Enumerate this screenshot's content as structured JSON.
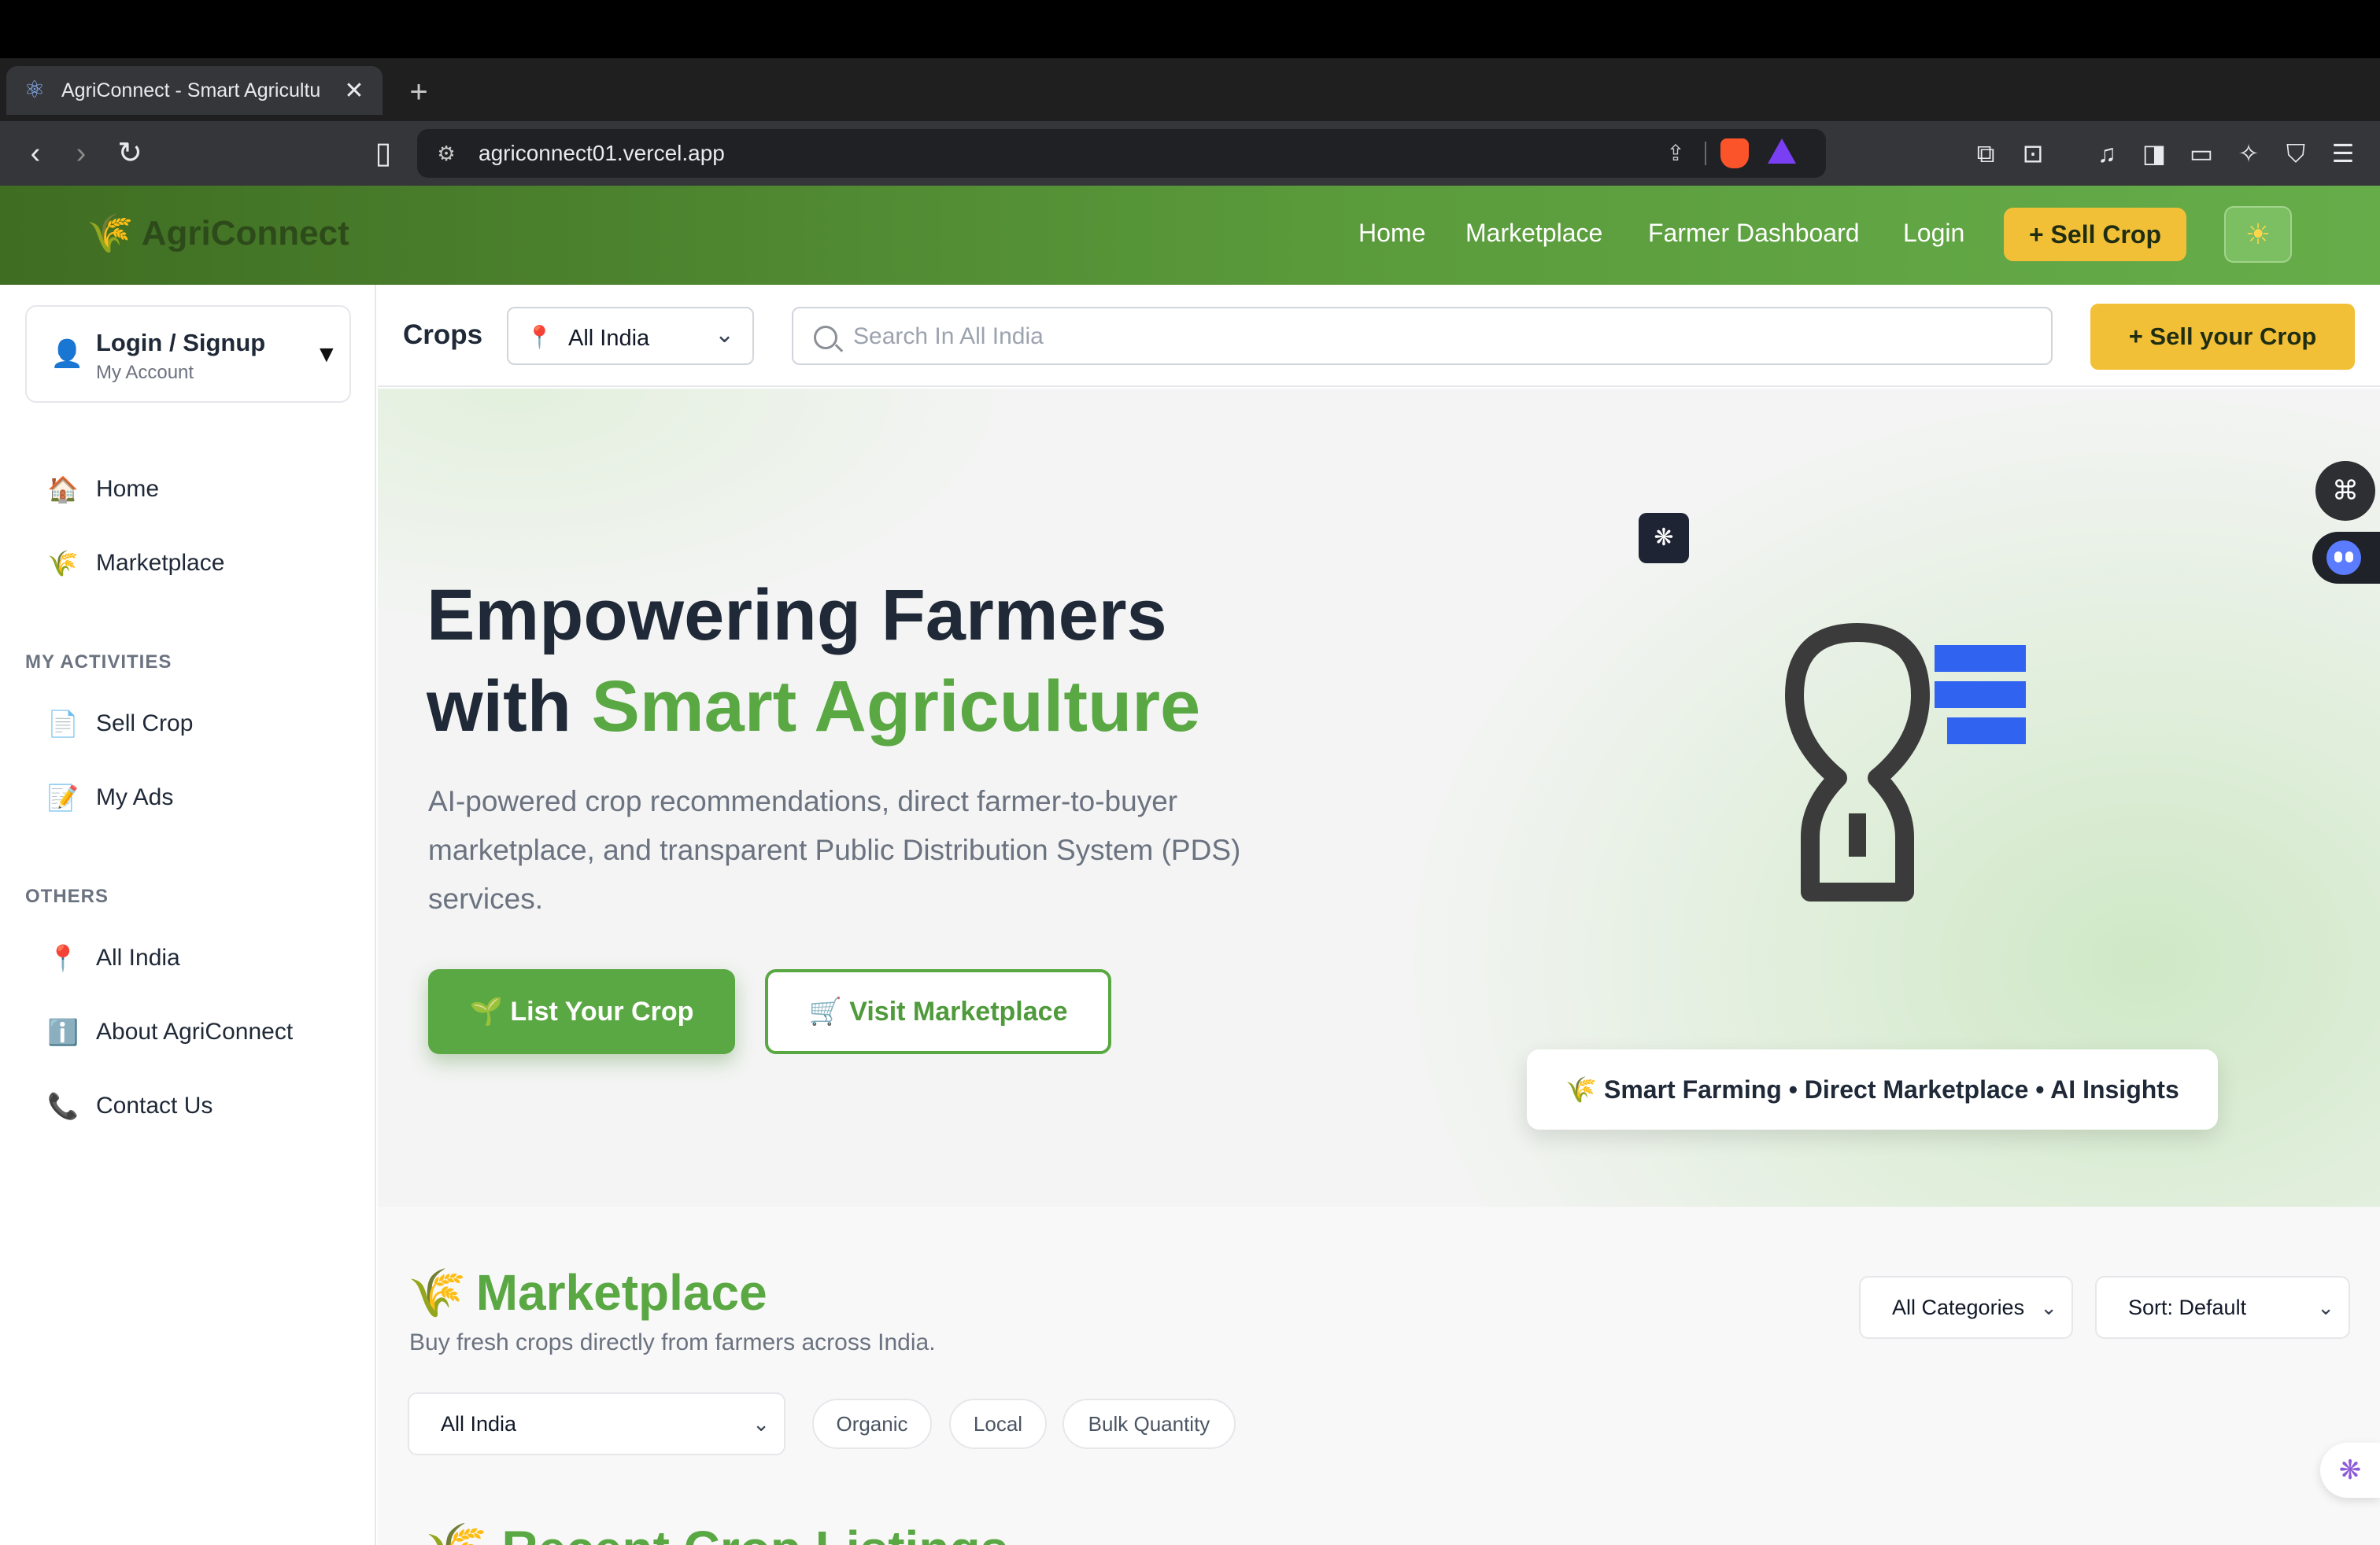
{
  "browser": {
    "tab_title": "AgriConnect - Smart Agricultu",
    "tab_close": "✕",
    "new_tab": "+",
    "url": "agriconnect01.vercel.app"
  },
  "header": {
    "brand_icon": "🌾",
    "brand": "AgriConnect",
    "nav": [
      "Home",
      "Marketplace",
      "Farmer Dashboard",
      "Login"
    ],
    "sell_crop": "+ Sell Crop",
    "theme_icon": "☀"
  },
  "sidebar": {
    "account_title": "Login / Signup",
    "account_subtitle": "My Account",
    "account_caret": "▼",
    "main_items": [
      {
        "icon": "🏠",
        "label": "Home"
      },
      {
        "icon": "🌾",
        "label": "Marketplace"
      }
    ],
    "activities_heading": "MY ACTIVITIES",
    "activity_items": [
      {
        "icon": "📄",
        "label": "Sell Crop"
      },
      {
        "icon": "📝",
        "label": "My Ads"
      }
    ],
    "others_heading": "OTHERS",
    "other_items": [
      {
        "icon": "📍",
        "label": "All India"
      },
      {
        "icon": "ℹ️",
        "label": "About AgriConnect"
      },
      {
        "icon": "📞",
        "label": "Contact Us"
      }
    ]
  },
  "filterbar": {
    "crops_label": "Crops",
    "location": "All India",
    "search_placeholder": "Search In All India",
    "sell_button": "+  Sell your Crop"
  },
  "hero": {
    "title_line1": "Empowering Farmers",
    "title_with": "with ",
    "title_accent": "Smart Agriculture",
    "description": "AI-powered crop recommendations, direct farmer-to-buyer marketplace, and transparent Public Distribution System (PDS) services.",
    "list_button": "🌱 List Your Crop",
    "visit_button": "🛒 Visit Marketplace",
    "tagline": "🌾 Smart Farming • Direct Marketplace • AI Insights"
  },
  "marketplace": {
    "title_icon": "🌾",
    "title": "Marketplace",
    "subtitle": "Buy fresh crops directly from farmers across India.",
    "category_select": "All Categories",
    "sort_select": "Sort: Default",
    "region_select": "All India",
    "chips": [
      "Organic",
      "Local",
      "Bulk Quantity"
    ],
    "next_heading": "🌾 Recent Crop Listings"
  },
  "colors": {
    "brand_green": "#5aa843",
    "accent_yellow": "#f2c037",
    "header_dark": "#3f6d22",
    "text_dark": "#1f2937"
  }
}
